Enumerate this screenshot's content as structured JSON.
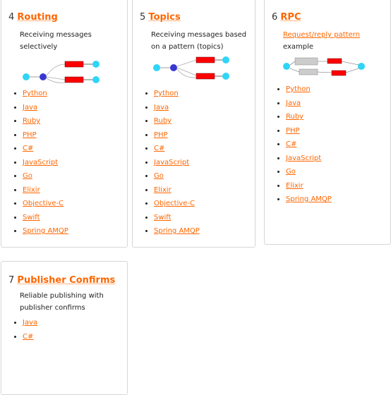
{
  "accent_color": "#ff6600",
  "cards": [
    {
      "number": "4",
      "title": "Routing",
      "description": "Receiving messages selectively",
      "languages": [
        "Python",
        "Java",
        "Ruby",
        "PHP",
        "C#",
        "JavaScript",
        "Go",
        "Elixir",
        "Objective-C",
        "Swift",
        "Spring AMQP"
      ]
    },
    {
      "number": "5",
      "title": "Topics",
      "description": "Receiving messages based on a pattern (topics)",
      "languages": [
        "Python",
        "Java",
        "Ruby",
        "PHP",
        "C#",
        "JavaScript",
        "Go",
        "Elixir",
        "Objective-C",
        "Swift",
        "Spring AMQP"
      ]
    },
    {
      "number": "6",
      "title": "RPC",
      "description_link": "Request/reply pattern",
      "description": "example",
      "languages": [
        "Python",
        "Java",
        "Ruby",
        "PHP",
        "C#",
        "JavaScript",
        "Go",
        "Elixir",
        "Spring AMQP"
      ]
    },
    {
      "number": "7",
      "title": "Publisher Confirms",
      "description": "Reliable publishing with publisher confirms",
      "languages": [
        "Java",
        "C#"
      ]
    }
  ]
}
